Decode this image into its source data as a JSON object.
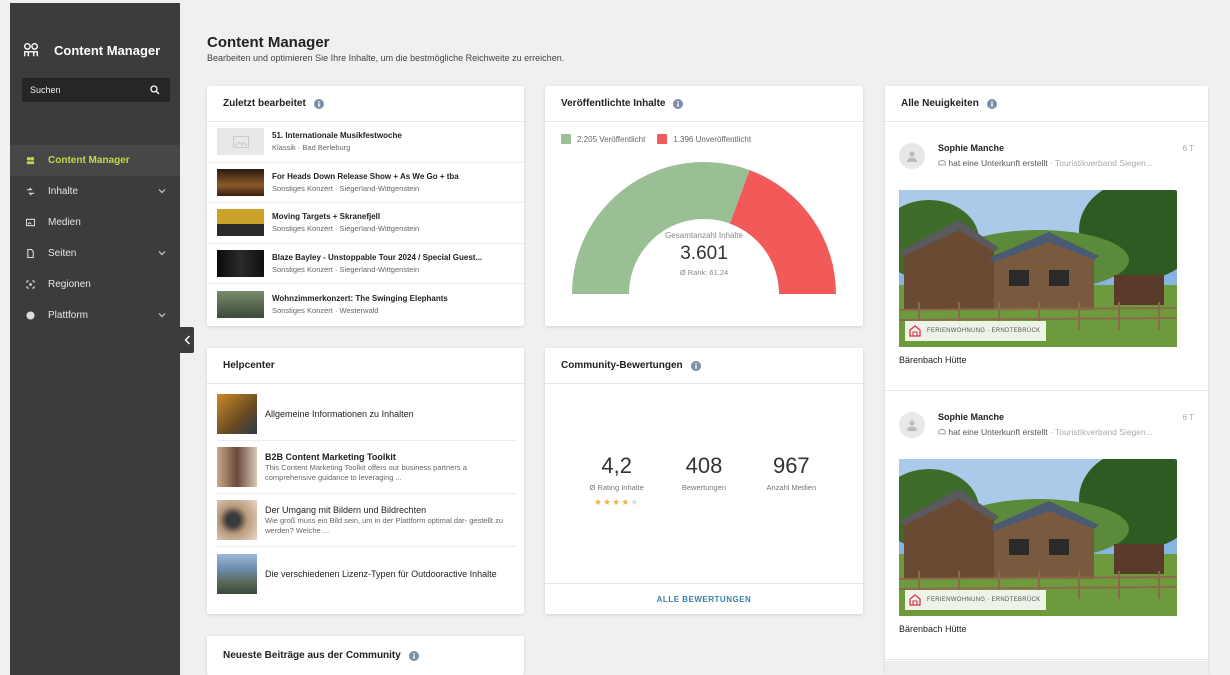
{
  "sidebar": {
    "title": "Content Manager",
    "search_label": "Suchen",
    "items": [
      {
        "label": "Content Manager"
      },
      {
        "label": "Inhalte"
      },
      {
        "label": "Medien"
      },
      {
        "label": "Seiten"
      },
      {
        "label": "Regionen"
      },
      {
        "label": "Plattform"
      }
    ]
  },
  "header": {
    "title": "Content Manager",
    "subtitle": "Bearbeiten und optimieren Sie Ihre Inhalte, um die bestmögliche Reichweite zu erreichen."
  },
  "recent": {
    "title": "Zuletzt bearbeitet",
    "items": [
      {
        "title": "51. Internationale Musikfestwoche",
        "sub": "Klassik · Bad Berleburg"
      },
      {
        "title": "For Heads Down Release Show + As We Go + tba",
        "sub": "Sonstiges Konzert · Siegerland-Wittgenstein"
      },
      {
        "title": "Moving Targets + Skranefjell",
        "sub": "Sonstiges Konzert · Siegerland-Wittgenstein"
      },
      {
        "title": "Blaze Bayley - Unstoppable Tour 2024 / Special Guest...",
        "sub": "Sonstiges Konzert · Siegerland-Wittgenstein"
      },
      {
        "title": "Wohnzimmerkonzert: The Swinging Elephants",
        "sub": "Sonstiges Konzert · Westerwald"
      }
    ]
  },
  "published": {
    "title": "Veröffentlichte Inhalte",
    "legend_published": "2.205 Veröffentlicht",
    "legend_unpublished": "1.396 Unveröffentlicht",
    "total_label": "Gesamtanzahl Inhalte",
    "total": "3.601",
    "rank": "Ø Rank: 61.24",
    "published_count": 2205,
    "unpublished_count": 1396,
    "color_published": "#9bbf94",
    "color_unpublished": "#f25a5a"
  },
  "help": {
    "title": "Helpcenter",
    "items": [
      {
        "title": "Allgemeine Informationen zu Inhalten",
        "desc": ""
      },
      {
        "title": "B2B Content Marketing Toolkit",
        "desc": "This Content Marketing Toolkit offers our business partners a comprehensive guidance to leveraging ..."
      },
      {
        "title": "Der Umgang mit Bildern und Bildrechten",
        "desc": "Wie groß muss ein Bild sein, um in der Plattform optimal dar- gestellt zu werden? Welche ..."
      },
      {
        "title": "Die verschiedenen Lizenz-Typen für Outdooractive Inhalte",
        "desc": ""
      }
    ]
  },
  "ratings": {
    "title": "Community-Bewertungen",
    "rating": "4,2",
    "rating_label": "Ø Rating Inhalte",
    "reviews": "408",
    "reviews_label": "Bewertungen",
    "media": "967",
    "media_label": "Anzahl Medien",
    "stars": 4.2,
    "all_label": "ALLE BEWERTUNGEN"
  },
  "community": {
    "title": "Neueste Beiträge aus der Community"
  },
  "news": {
    "title": "Alle Neuigkeiten",
    "items": [
      {
        "name": "Sophie Manche",
        "time": "6 T",
        "action": "hat eine Unterkunft erstellt",
        "org": "· Touristikverband Siegen...",
        "tag": "FERIENWOHNUNG · ERNDTEBRÜCK",
        "place": "Bärenbach Hütte"
      },
      {
        "name": "Sophie Manche",
        "time": "6 T",
        "action": "hat eine Unterkunft erstellt",
        "org": "· Touristikverband Siegen...",
        "tag": "FERIENWOHNUNG · ERNDTEBRÜCK",
        "place": "Bärenbach Hütte"
      }
    ]
  }
}
